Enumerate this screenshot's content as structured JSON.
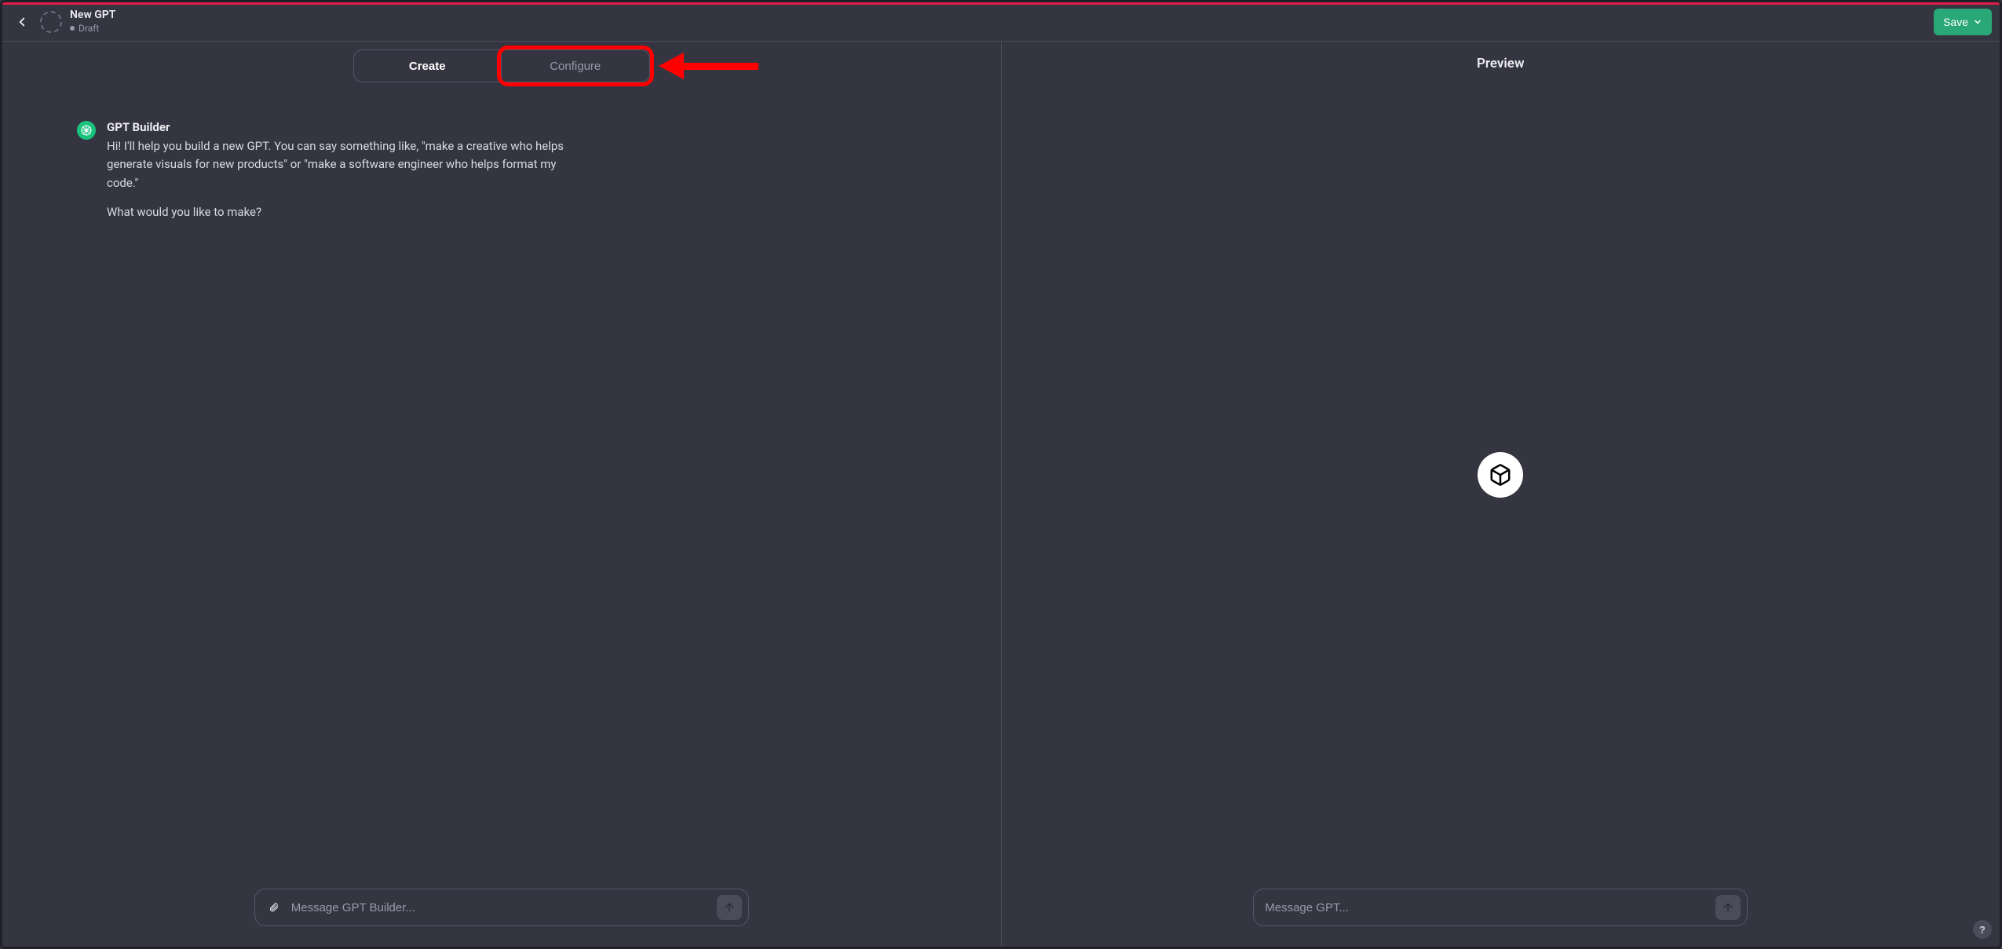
{
  "header": {
    "title": "New GPT",
    "status_label": "Draft",
    "save_label": "Save"
  },
  "tabs": {
    "create_label": "Create",
    "configure_label": "Configure"
  },
  "preview": {
    "title": "Preview"
  },
  "chat": {
    "builder_name": "GPT Builder",
    "message_line1": "Hi! I'll help you build a new GPT. You can say something like, \"make a creative who helps generate visuals for new products\" or \"make a software engineer who helps format my code.\"",
    "message_line2": "What would you like to make?"
  },
  "composer": {
    "left_placeholder": "Message GPT Builder...",
    "right_placeholder": "Message GPT..."
  },
  "help": {
    "label": "?"
  },
  "annotation": {
    "highlighted_tab": "Configure"
  }
}
